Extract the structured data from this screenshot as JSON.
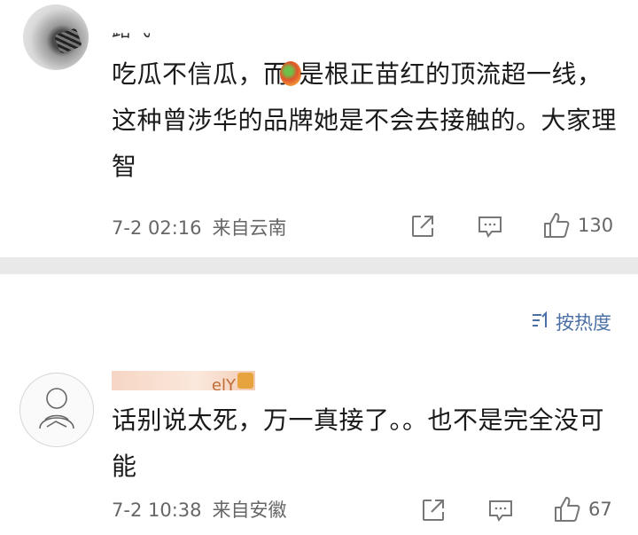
{
  "comments": [
    {
      "username": "路飞",
      "text_part1": "吃瓜不信瓜，而",
      "text_part2": "是根正苗红的顶流超一线，这种曾涉华的品牌她是不会去接触的。大家理智",
      "timestamp": "7-2 02:16",
      "location": "来自云南",
      "like_count": "130",
      "icons": {
        "share": "share-icon",
        "comment": "comment-icon",
        "like": "like-icon"
      }
    },
    {
      "username": "elY",
      "text": "话别说太死，万一真接了。。也不是完全没可能",
      "timestamp": "7-2 10:38",
      "location": "来自安徽",
      "like_count": "67",
      "icons": {
        "share": "share-icon",
        "comment": "comment-icon",
        "like": "like-icon"
      }
    }
  ],
  "sort": {
    "label": "按热度",
    "icon": "sort-icon"
  },
  "colors": {
    "link": "#4a6fa5",
    "divider": "#e9e9e9",
    "meta": "#666666"
  }
}
